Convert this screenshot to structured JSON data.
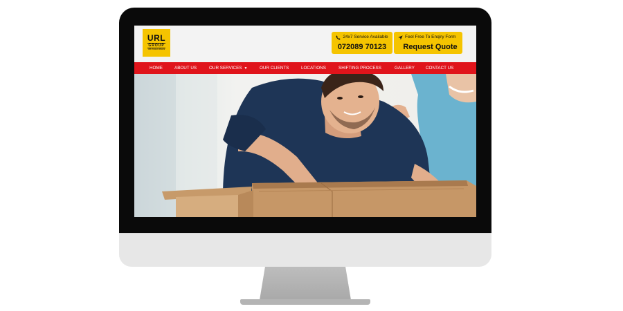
{
  "site": {
    "logo": {
      "main": "URL",
      "sub": "GROUP",
      "tagline": "URL Packers Movers"
    },
    "contact": {
      "service_label": "24x7 Service Available",
      "phone": "072089 70123",
      "form_label": "Feel Free To Enqiry Form",
      "quote_label": "Request Quote"
    },
    "nav": [
      {
        "label": "HOME"
      },
      {
        "label": "ABOUT US"
      },
      {
        "label": "OUR SERVICES"
      },
      {
        "label": "OUR CLIENTS"
      },
      {
        "label": "LOCATIONS"
      },
      {
        "label": "SHIFTING PROCESS"
      },
      {
        "label": "GALLERY"
      },
      {
        "label": "CONTACT US"
      }
    ],
    "hero": {
      "image": "man-and-woman-unpacking-cardboard-box"
    }
  },
  "colors": {
    "brand_yellow": "#f5c400",
    "nav_red": "#e0141b",
    "monitor_bezel": "#0a0a0a",
    "monitor_chin": "#e7e7e7",
    "stand": "#b4b4b4"
  },
  "icons": {
    "phone": "phone-icon",
    "send": "location-arrow-icon",
    "dropdown": "caret-down-icon"
  }
}
